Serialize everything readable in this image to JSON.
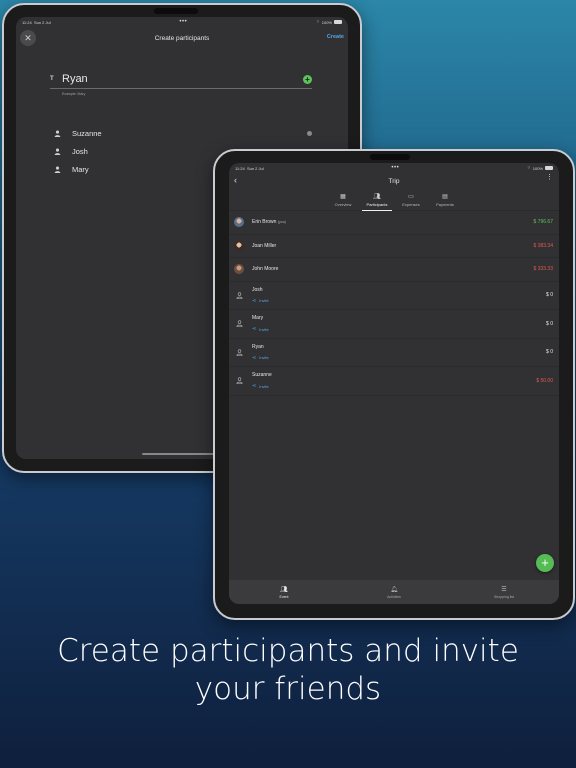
{
  "back_screen": {
    "status": {
      "time": "11:24",
      "date": "Sun 2 Jul",
      "battery": "100%"
    },
    "nav": {
      "title": "Create participants",
      "create_label": "Create"
    },
    "input": {
      "value": "Ryan",
      "helper": "Example: Mary"
    },
    "participants": [
      {
        "name": "Suzanne"
      },
      {
        "name": "Josh"
      },
      {
        "name": "Mary"
      }
    ]
  },
  "front_screen": {
    "status": {
      "time": "11:24",
      "date": "Sun 2 Jul",
      "battery": "100%"
    },
    "nav": {
      "title": "Trip"
    },
    "tabs": [
      {
        "label": "Overview",
        "icon": "grid-icon"
      },
      {
        "label": "Participants",
        "icon": "people-icon"
      },
      {
        "label": "Expenses",
        "icon": "card-icon"
      },
      {
        "label": "Payments",
        "icon": "cash-icon"
      }
    ],
    "participants": [
      {
        "name": "Erin Brown",
        "tag": "(you)",
        "amount": "$ 796.67",
        "status": "positive"
      },
      {
        "name": "Joan Miller",
        "amount": "$ 383.34",
        "status": "negative"
      },
      {
        "name": "John Moore",
        "amount": "$ 333.33",
        "status": "negative"
      },
      {
        "name": "Josh",
        "invite": "Invite",
        "amount": "$ 0",
        "status": "zero"
      },
      {
        "name": "Mary",
        "invite": "Invite",
        "amount": "$ 0",
        "status": "zero"
      },
      {
        "name": "Ryan",
        "invite": "Invite",
        "amount": "$ 0",
        "status": "zero"
      },
      {
        "name": "Suzanne",
        "invite": "Invite",
        "amount": "$ 50.00",
        "status": "negative"
      }
    ],
    "bottom_nav": [
      {
        "label": "Event",
        "icon": "people-icon"
      },
      {
        "label": "Activities",
        "icon": "bell-icon"
      },
      {
        "label": "Shopping list",
        "icon": "checklist-icon"
      }
    ],
    "colors": {
      "positive": "#5cc25c",
      "negative": "#e05a52",
      "accent": "#4fa8e6"
    }
  },
  "caption": {
    "line1": "Create participants and invite",
    "line2": "your friends"
  }
}
